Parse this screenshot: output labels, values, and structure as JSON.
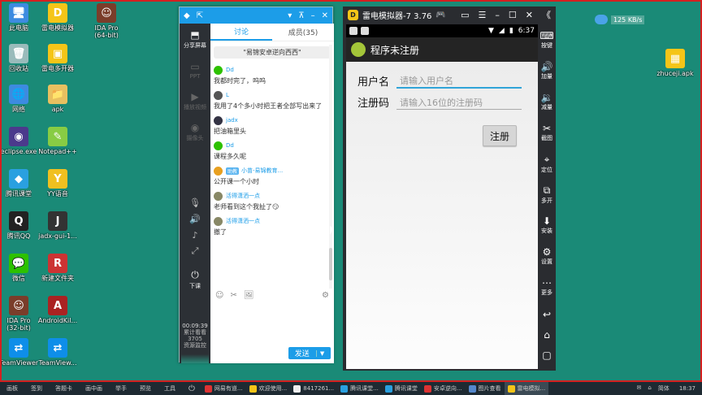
{
  "desktop": {
    "icons": [
      {
        "label": "此电脑",
        "color": "#3d8be0",
        "glyph": "🖥"
      },
      {
        "label": "雷电模拟器",
        "color": "#f5c518",
        "glyph": "D"
      },
      {
        "label": "IDA Pro\n(64-bit)",
        "color": "#7a3d2a",
        "glyph": "☺"
      },
      {
        "label": "回收站",
        "color": "#9bb",
        "glyph": "🗑"
      },
      {
        "label": "雷电多开器",
        "color": "#f5c518",
        "glyph": "▣"
      },
      {
        "label": "网络",
        "color": "#3d8be0",
        "glyph": "🌐"
      },
      {
        "label": "apk",
        "color": "#e8c060",
        "glyph": "📁"
      },
      {
        "label": "eclipse.exe",
        "color": "#4b3a8c",
        "glyph": "◉"
      },
      {
        "label": "Notepad++",
        "color": "#8c4",
        "glyph": "✎"
      },
      {
        "label": "腾讯课堂",
        "color": "#2aa0e0",
        "glyph": "◆"
      },
      {
        "label": "YY语音",
        "color": "#f0c020",
        "glyph": "Y"
      },
      {
        "label": "腾讯QQ",
        "color": "#222",
        "glyph": "Q"
      },
      {
        "label": "jadx-gui-1...",
        "color": "#333",
        "glyph": "J"
      },
      {
        "label": "微信",
        "color": "#2dc100",
        "glyph": "💬"
      },
      {
        "label": "新建文件夹",
        "color": "#c33",
        "glyph": "R"
      },
      {
        "label": "IDA Pro\n(32-bit)",
        "color": "#7a3d2a",
        "glyph": "☺"
      },
      {
        "label": "AndroidKil...",
        "color": "#a22",
        "glyph": "A"
      },
      {
        "label": "TeamViewer",
        "color": "#0e8ee9",
        "glyph": "⇄"
      },
      {
        "label": "TeamView...",
        "color": "#0e8ee9",
        "glyph": "⇄"
      }
    ],
    "right_icon": {
      "label": "zhuceji.apk",
      "color": "#f5c518",
      "glyph": "▦"
    }
  },
  "speed": {
    "value": "125 KB/s"
  },
  "classroom": {
    "left_tools": [
      {
        "label": "分享屏幕",
        "glyph": "⬒"
      },
      {
        "label": "PPT",
        "glyph": "▭"
      },
      {
        "label": "播放视频",
        "glyph": "▶"
      },
      {
        "label": "摄像头",
        "glyph": "◉"
      }
    ],
    "mini_tools": [
      "🎙",
      "🔊",
      "♪",
      "⤢"
    ],
    "exit_label": "下课",
    "timer": "00:09:39",
    "stats": [
      "累计看看",
      "3705",
      "资源监控"
    ],
    "tabs": {
      "discuss": "讨论",
      "members": "成员(35)"
    },
    "notice": "\"易锦安卓逆向西西\"",
    "messages": [
      {
        "name": "Dd",
        "text": "我都时完了，呜呜",
        "avatar": "#2dc100"
      },
      {
        "name": "L",
        "text": "我用了4个多小时把王者全部写出来了",
        "avatar": "#555"
      },
      {
        "name": "jadx",
        "text": "把油箱里头",
        "avatar": "#334"
      },
      {
        "name": "Dd",
        "text": "课程多久呢",
        "avatar": "#2dc100"
      },
      {
        "name": "小苗-易锦教育...",
        "badge": "助教",
        "text": "公开课一个小时",
        "avatar": "#e8a020"
      },
      {
        "name": "活得潇洒一点",
        "text": "老师看到这个我扯了😏",
        "avatar": "#886"
      },
      {
        "name": "活得潇洒一点",
        "text": "撤了",
        "avatar": "#886"
      }
    ],
    "toolbar": [
      "☺",
      "✂",
      "🖼",
      "⚙"
    ],
    "send_label": "发送",
    "send_arrow": "▼"
  },
  "emulator": {
    "title": "雷电模拟器-7 3.76",
    "title_controls": [
      "▭",
      "☰",
      "–",
      "☐",
      "✕",
      "《"
    ],
    "status_time": "6:37",
    "status_icons": [
      "▼",
      "◢",
      "▮"
    ],
    "app_title": "程序未注册",
    "username_label": "用户名",
    "username_placeholder": "请输入用户名",
    "code_label": "注册码",
    "code_placeholder": "请输入16位的注册码",
    "register_label": "注册",
    "side_buttons": [
      {
        "label": "按键",
        "glyph": "⌨"
      },
      {
        "label": "加量",
        "glyph": "🔊"
      },
      {
        "label": "减量",
        "glyph": "🔉"
      },
      {
        "label": "截图",
        "glyph": "✂"
      },
      {
        "label": "定位",
        "glyph": "⌖"
      },
      {
        "label": "多开",
        "glyph": "⧉"
      },
      {
        "label": "安装",
        "glyph": "⬇"
      },
      {
        "label": "设置",
        "glyph": "⚙"
      },
      {
        "label": "更多",
        "glyph": "⋯"
      }
    ],
    "nav_buttons": [
      "↩",
      "⌂",
      "▢"
    ]
  },
  "taskbar": {
    "left_items": [
      "画板",
      "签到",
      "答题卡",
      "画中画",
      "举手",
      "预览",
      "工具"
    ],
    "power": "⏻",
    "apps": [
      {
        "label": "网易有道...",
        "color": "#d33"
      },
      {
        "label": "欢迎使用...",
        "color": "#f5c518"
      },
      {
        "label": "8417261...",
        "color": "#eee"
      },
      {
        "label": "腾讯课堂...",
        "color": "#2aa0e0"
      },
      {
        "label": "腾讯课堂",
        "color": "#2aa0e0"
      },
      {
        "label": "安卓逆向...",
        "color": "#d33"
      },
      {
        "label": "图片查看",
        "color": "#58c"
      },
      {
        "label": "雷电模拟...",
        "color": "#f5c518"
      }
    ],
    "tray": [
      "✉",
      "⌂",
      "简体"
    ],
    "time": "18:37"
  }
}
